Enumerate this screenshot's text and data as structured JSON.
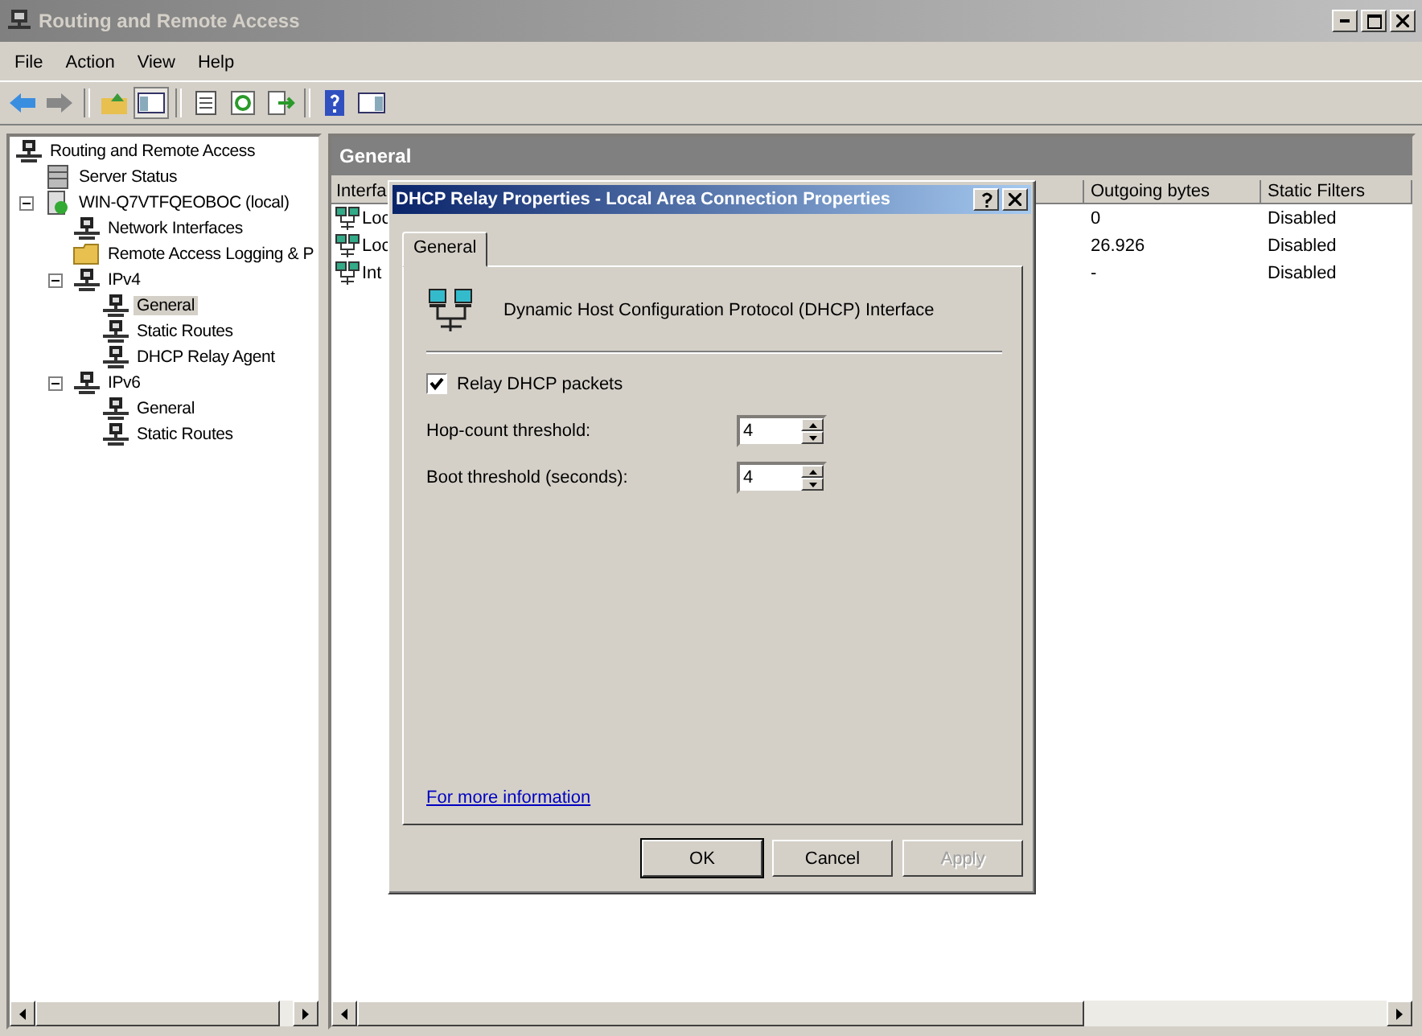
{
  "window": {
    "title": "Routing and Remote Access"
  },
  "menu": [
    "File",
    "Action",
    "View",
    "Help"
  ],
  "tree": [
    {
      "label": "Routing and Remote Access",
      "kind": "network",
      "selected": false,
      "children": [
        {
          "label": "Server Status",
          "kind": "server",
          "selected": false
        },
        {
          "label": "WIN-Q7VTFQEOBOC (local)",
          "kind": "computer",
          "selected": false,
          "expanded": true,
          "children": [
            {
              "label": "Network Interfaces",
              "kind": "network",
              "selected": false
            },
            {
              "label": "Remote Access Logging & P",
              "kind": "folder",
              "selected": false
            },
            {
              "label": "IPv4",
              "kind": "network",
              "selected": false,
              "expanded": true,
              "children": [
                {
                  "label": "General",
                  "kind": "network",
                  "selected": true
                },
                {
                  "label": "Static Routes",
                  "kind": "network",
                  "selected": false
                },
                {
                  "label": "DHCP Relay Agent",
                  "kind": "network",
                  "selected": false
                }
              ]
            },
            {
              "label": "IPv6",
              "kind": "network",
              "selected": false,
              "expanded": true,
              "children": [
                {
                  "label": "General",
                  "kind": "network",
                  "selected": false
                },
                {
                  "label": "Static Routes",
                  "kind": "network",
                  "selected": false
                }
              ]
            }
          ]
        }
      ]
    }
  ],
  "details": {
    "title": "General",
    "columns": [
      "Interfa",
      "Outgoing bytes",
      "Static Filters"
    ],
    "rows": [
      [
        "Loc",
        "0",
        "Disabled"
      ],
      [
        "Loc",
        "26.926",
        "Disabled"
      ],
      [
        "Int",
        "-",
        "Disabled"
      ]
    ]
  },
  "dialog": {
    "title": "DHCP Relay Properties - Local Area Connection Properties",
    "tabs": [
      {
        "label": "General",
        "selected": true
      }
    ],
    "description": "Dynamic Host Configuration Protocol (DHCP) Interface",
    "relay": {
      "label": "Relay DHCP packets",
      "checked": true
    },
    "fields": [
      {
        "label": "Hop-count threshold:",
        "value": "4"
      },
      {
        "label": "Boot threshold (seconds):",
        "value": "4"
      }
    ],
    "link": "For more information",
    "buttons": [
      {
        "label": "OK",
        "default": true,
        "disabled": false
      },
      {
        "label": "Cancel",
        "default": false,
        "disabled": false
      },
      {
        "label": "Apply",
        "default": false,
        "disabled": true
      }
    ]
  }
}
